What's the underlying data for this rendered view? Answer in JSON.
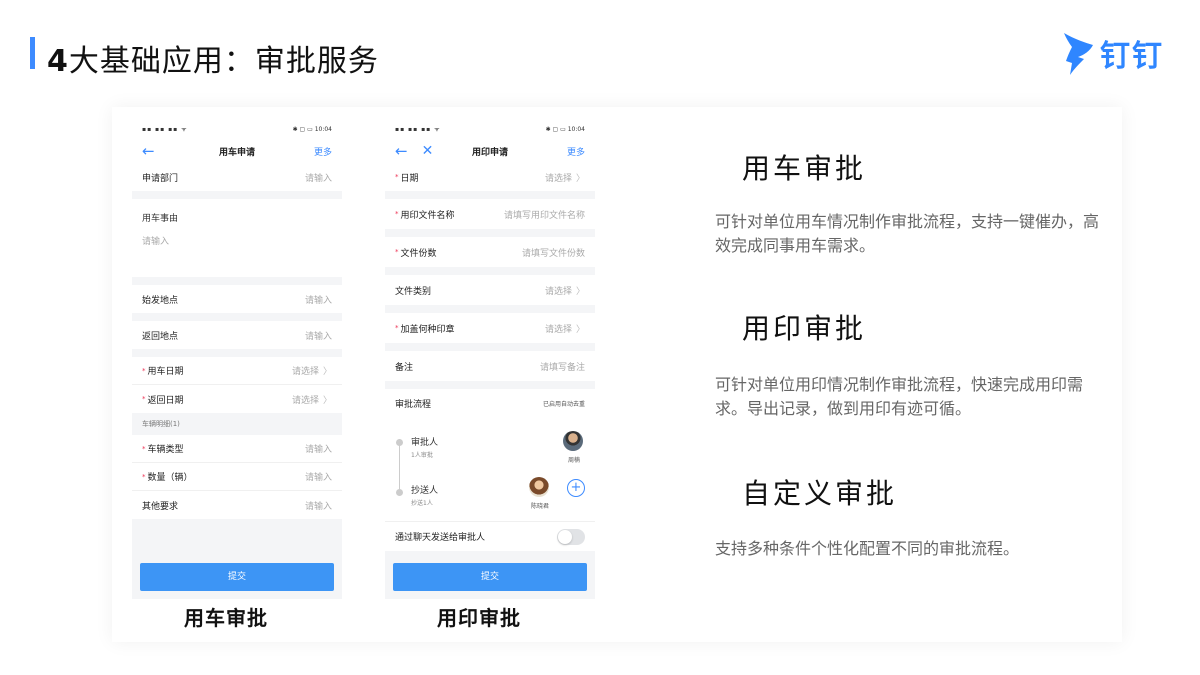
{
  "header": {
    "title_number": "4",
    "title_rest": "大基础应用：审批服务",
    "logo_text": "钉钉"
  },
  "phone1": {
    "status_left": "▪▪ ▪▪ ▪▪ ᯤ",
    "status_right": "✱ ▢ ▭ 10:04",
    "title": "用车申请",
    "more": "更多",
    "dept_label": "申请部门",
    "dept_ph": "请输入",
    "reason_label": "用车事由",
    "reason_ph": "请输入",
    "start_label": "始发地点",
    "start_ph": "请输入",
    "return_label": "返回地点",
    "return_ph": "请输入",
    "date_label": "用车日期",
    "date_ph": "请选择",
    "rdate_label": "返回日期",
    "rdate_ph": "请选择",
    "section": "车辆明细(1)",
    "type_label": "车辆类型",
    "type_ph": "请输入",
    "qty_label": "数量（辆）",
    "qty_ph": "请输入",
    "other_label": "其他要求",
    "other_ph": "请输入",
    "submit": "提交"
  },
  "phone2": {
    "status_left": "▪▪ ▪▪ ▪▪ ᯤ",
    "status_right": "✱ ▢ ▭ 10:04",
    "title": "用印申请",
    "more": "更多",
    "date_label": "日期",
    "date_ph": "请选择",
    "file_label": "用印文件名称",
    "file_ph": "请填写用印文件名称",
    "copies_label": "文件份数",
    "copies_ph": "请填写文件份数",
    "cat_label": "文件类别",
    "cat_ph": "请选择",
    "seal_label": "加盖何种印章",
    "seal_ph": "请选择",
    "note_label": "备注",
    "note_ph": "请填写备注",
    "flow_label": "审批流程",
    "flow_right": "已启用自动去重",
    "approver": "审批人",
    "approver_sub": "1人审批",
    "approver_name": "周楠",
    "cc": "抄送人",
    "cc_sub": "抄送1人",
    "cc_name": "陈晓君",
    "chat_label": "通过聊天发送给审批人",
    "submit": "提交"
  },
  "captions": {
    "cap1": "用车审批",
    "cap2": "用印审批"
  },
  "features": [
    {
      "title": "用车审批",
      "desc": "可针对单位用车情况制作审批流程，支持一键催办，高效完成同事用车需求。"
    },
    {
      "title": "用印审批",
      "desc": "可针对单位用印情况制作审批流程，快速完成用印需求。导出记录，做到用印有迹可循。"
    },
    {
      "title": "自定义审批",
      "desc": "支持多种条件个性化配置不同的审批流程。"
    }
  ],
  "colors": {
    "accent": "#3d8bff",
    "button": "#3d95f5"
  }
}
